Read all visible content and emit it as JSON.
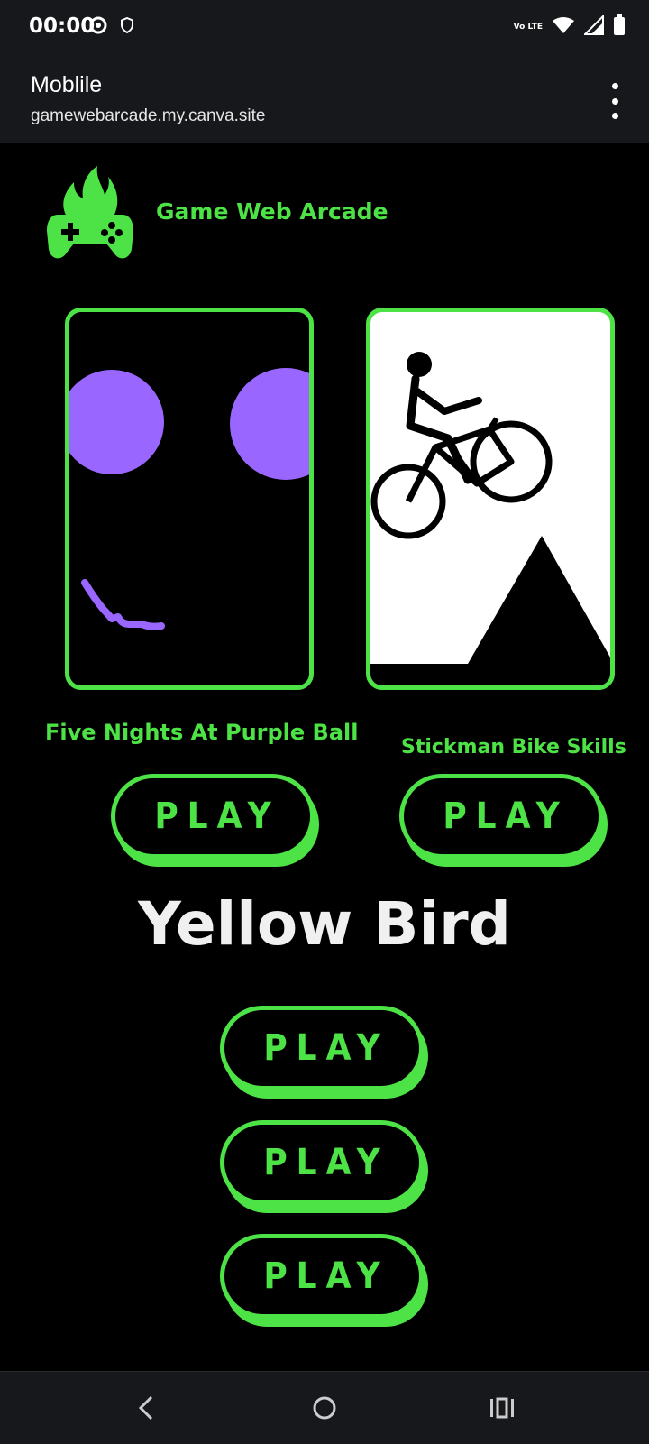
{
  "status": {
    "time": "00:00",
    "network_label": "Vo LTE"
  },
  "browser": {
    "title": "Moblile",
    "url": "gamewebarcade.my.canva.site"
  },
  "site": {
    "brand": "Game Web Arcade"
  },
  "games": [
    {
      "title": "Five Nights At Purple Ball",
      "button": "PLAY"
    },
    {
      "title": "Stickman Bike Skills",
      "button": "PLAY"
    }
  ],
  "section": {
    "heading": "Yellow Bird"
  },
  "more_buttons": [
    "PLAY",
    "PLAY",
    "PLAY"
  ],
  "colors": {
    "accent": "#4de346",
    "purple": "#9966ff",
    "bar": "#17181c"
  }
}
